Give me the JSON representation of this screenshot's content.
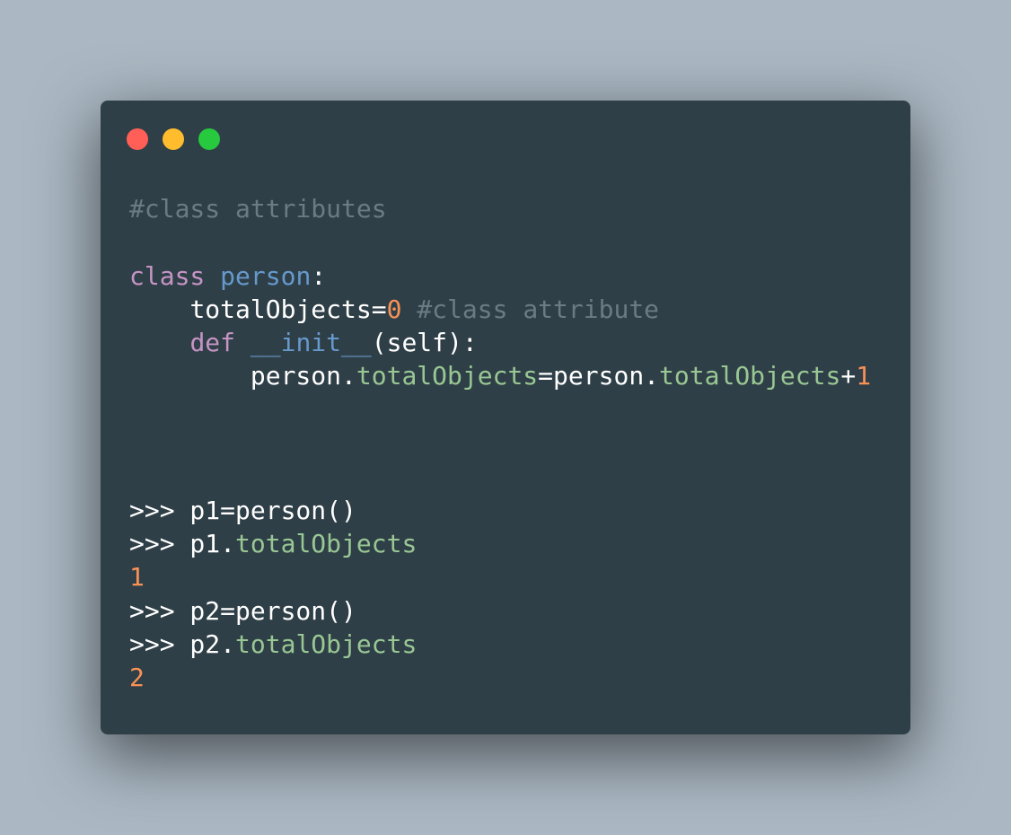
{
  "window": {
    "controls": {
      "close_color": "#ff5f56",
      "minimize_color": "#ffbd2e",
      "maximize_color": "#27c93f"
    }
  },
  "colors": {
    "background": "#abb8c3",
    "editor": "#2f3f47",
    "comment": "#6b7a83",
    "keyword": "#c594c5",
    "class_name": "#6699cc",
    "number": "#f99157",
    "attribute": "#99c794",
    "text": "#ffffff"
  },
  "code": {
    "line1": {
      "comment": "#class attributes"
    },
    "line3": {
      "keyword": "class",
      "class_name": "person",
      "colon": ":"
    },
    "line4": {
      "indent": "    ",
      "name": "totalObjects=",
      "value": "0",
      "comment": "#class attribute"
    },
    "line5": {
      "indent": "    ",
      "keyword": "def",
      "method": "__init__",
      "params": "(self):"
    },
    "line6": {
      "indent": "        ",
      "obj1": "person.",
      "attr1": "totalObjects",
      "eq": "=person.",
      "attr2": "totalObjects",
      "plus": "+",
      "value": "1"
    },
    "line10": {
      "text": ">>> p1=person()"
    },
    "line11": {
      "prompt": ">>> p1.",
      "attr": "totalObjects"
    },
    "line12": {
      "output": "1"
    },
    "line13": {
      "text": ">>> p2=person()"
    },
    "line14": {
      "prompt": ">>> p2.",
      "attr": "totalObjects"
    },
    "line15": {
      "output": "2"
    }
  }
}
